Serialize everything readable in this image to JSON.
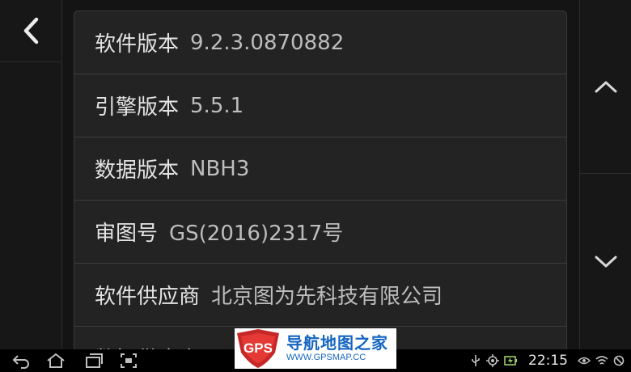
{
  "nav": {
    "back_icon": "chevron-left-icon"
  },
  "info_rows": [
    {
      "label": "软件版本",
      "value": "9.2.3.0870882"
    },
    {
      "label": "引擎版本",
      "value": "5.5.1"
    },
    {
      "label": "数据版本",
      "value": "NBH3"
    },
    {
      "label": "审图号",
      "value": "GS(2016)2317号"
    },
    {
      "label": "软件供应商",
      "value": "北京图为先科技有限公司"
    },
    {
      "label": "数据供应商",
      "value": ""
    }
  ],
  "scroll": {
    "up_icon": "chevron-up-icon",
    "down_icon": "chevron-down-icon"
  },
  "system_bar": {
    "time": "22:15",
    "icons": [
      "back-icon",
      "home-icon",
      "recent-apps-icon",
      "screenshot-icon",
      "usb-icon",
      "gps-icon",
      "battery-charging-icon",
      "eye-icon",
      "wifi-icon",
      "no-signal-icon"
    ]
  },
  "watermark": {
    "logo_text": "GPS",
    "title": "导航地图之家",
    "url": "WWW.GPSMAP.CC"
  },
  "colors": {
    "background": "#141414",
    "panel": "#232323",
    "divider": "#3b3b3b",
    "text": "#e3e3e3",
    "watermark_blue": "#1565c0",
    "logo_red": "#c62828"
  }
}
